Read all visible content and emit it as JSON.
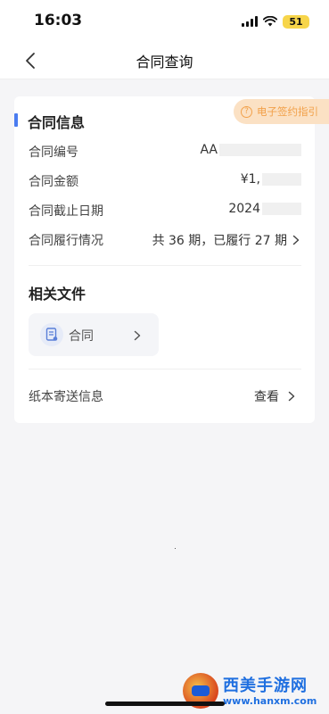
{
  "status_bar": {
    "time": "16:03",
    "battery": "51"
  },
  "nav": {
    "title": "合同查询"
  },
  "guide_badge": {
    "label": "电子签约指引"
  },
  "contract_info": {
    "title": "合同信息",
    "rows": [
      {
        "label": "合同编号",
        "value": "AA"
      },
      {
        "label": "合同金额",
        "value": "¥1,"
      },
      {
        "label": "合同截止日期",
        "value": "2024"
      },
      {
        "label": "合同履行情况",
        "value": "共 36 期，已履行 27 期"
      }
    ]
  },
  "files": {
    "title": "相关文件",
    "items": [
      {
        "label": "合同"
      }
    ]
  },
  "paper_delivery": {
    "label": "纸本寄送信息",
    "action": "查看"
  },
  "watermark": {
    "title": "西美手游网",
    "url": "www.hanxm.com"
  },
  "colors": {
    "accent": "#4a7cf0",
    "guide": "#f2a14a",
    "guide_bg": "#fbe1c4"
  }
}
